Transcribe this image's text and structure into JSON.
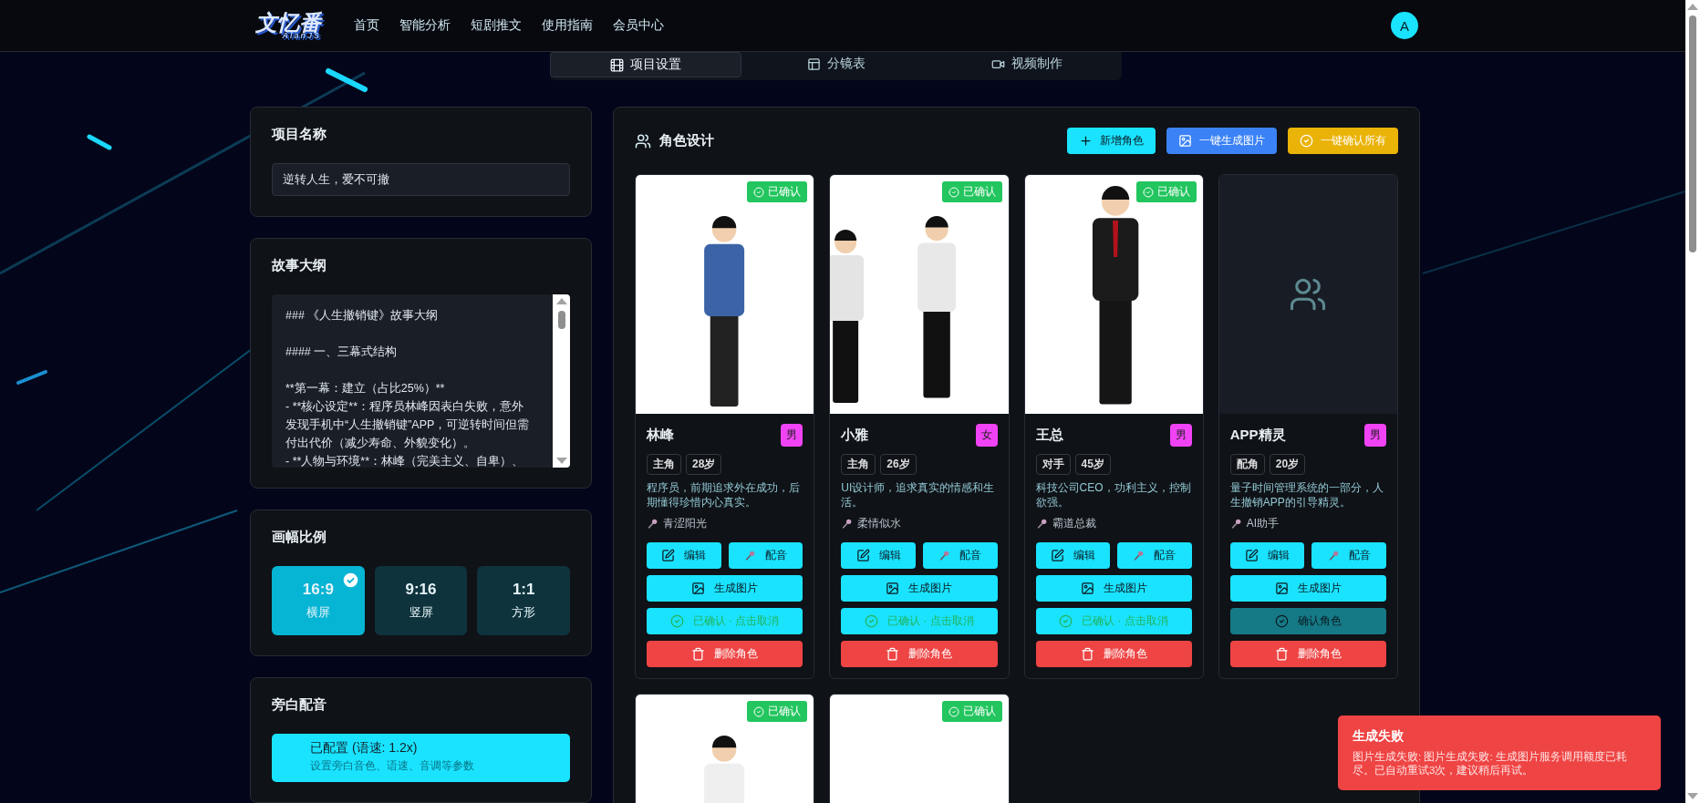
{
  "header": {
    "logo": {
      "title": "文忆番",
      "subtitle": "AlanJS"
    },
    "nav": [
      {
        "label": "首页"
      },
      {
        "label": "智能分析"
      },
      {
        "label": "短剧推文"
      },
      {
        "label": "使用指南"
      },
      {
        "label": "会员中心"
      }
    ],
    "avatar": "A"
  },
  "tabs": [
    {
      "label": "项目设置",
      "selected": true
    },
    {
      "label": "分镜表",
      "selected": false
    },
    {
      "label": "视频制作",
      "selected": false
    }
  ],
  "project": {
    "title": "项目名称",
    "value": "逆转人生，爱不可撤"
  },
  "outline": {
    "title": "故事大纲",
    "value": "### 《人生撤销键》故事大纲\n\n#### 一、三幕式结构\n\n**第一幕：建立（占比25%）**\n- **核心设定**：程序员林峰因表白失败，意外发现手机中“人生撤销键”APP，可逆转时间但需付出代价（减少寿命、外貌变化）。\n- **人物与环境**：林峰（完美主义、自卑）、"
  },
  "ratio": {
    "title": "画幅比例",
    "options": [
      {
        "value": "16:9",
        "label": "横屏",
        "selected": true
      },
      {
        "value": "9:16",
        "label": "竖屏",
        "selected": false
      },
      {
        "value": "1:1",
        "label": "方形",
        "selected": false
      }
    ]
  },
  "narration": {
    "title": "旁白配音",
    "status": "已配置 (语速: 1.2x)",
    "hint": "设置旁白音色、语速、音调等参数"
  },
  "characters_panel": {
    "title": "角色设计",
    "actions": [
      "新增角色",
      "一键生成图片",
      "一键确认所有"
    ],
    "characters": [
      {
        "kind": "picture",
        "confirmed": true,
        "badge": "已确认",
        "name": "林峰",
        "gender": "男",
        "role": "主角",
        "age": "28岁",
        "description": "程序员，前期追求外在成功，后期懂得珍惜内心真实。",
        "voice": "青涩阳光",
        "buttons": {
          "edit": "编辑",
          "dub": "配音",
          "generate": "生成图片",
          "confirm": "已确认 · 点击取消",
          "delete": "删除角色"
        }
      },
      {
        "kind": "picture",
        "confirmed": true,
        "badge": "已确认",
        "name": "小雅",
        "gender": "女",
        "role": "主角",
        "age": "26岁",
        "description": "UI设计师，追求真实的情感和生活。",
        "voice": "柔情似水",
        "buttons": {
          "edit": "编辑",
          "dub": "配音",
          "generate": "生成图片",
          "confirm": "已确认 · 点击取消",
          "delete": "删除角色"
        }
      },
      {
        "kind": "picture",
        "confirmed": true,
        "badge": "已确认",
        "name": "王总",
        "gender": "男",
        "role": "对手",
        "age": "45岁",
        "description": "科技公司CEO，功利主义，控制欲强。",
        "voice": "霸道总裁",
        "buttons": {
          "edit": "编辑",
          "dub": "配音",
          "generate": "生成图片",
          "confirm": "已确认 · 点击取消",
          "delete": "删除角色"
        }
      },
      {
        "kind": "placeholder",
        "confirmed": false,
        "name": "APP精灵",
        "gender": "男",
        "role": "配角",
        "age": "20岁",
        "description": "量子时间管理系统的一部分，人生撤销APP的引导精灵。",
        "voice": "AI助手",
        "buttons": {
          "edit": "编辑",
          "dub": "配音",
          "generate": "生成图片",
          "confirm": "确认角色",
          "delete": "删除角色"
        }
      },
      {
        "kind": "picture",
        "confirmed": true,
        "badge": "已确认"
      },
      {
        "kind": "picture",
        "confirmed": true,
        "badge": "已确认"
      }
    ]
  },
  "toast": {
    "title": "生成失败",
    "message": "图片生成失败: 图片生成失败: 生成图片服务调用额度已耗尽。已自动重试3次，建议稍后再试。"
  }
}
